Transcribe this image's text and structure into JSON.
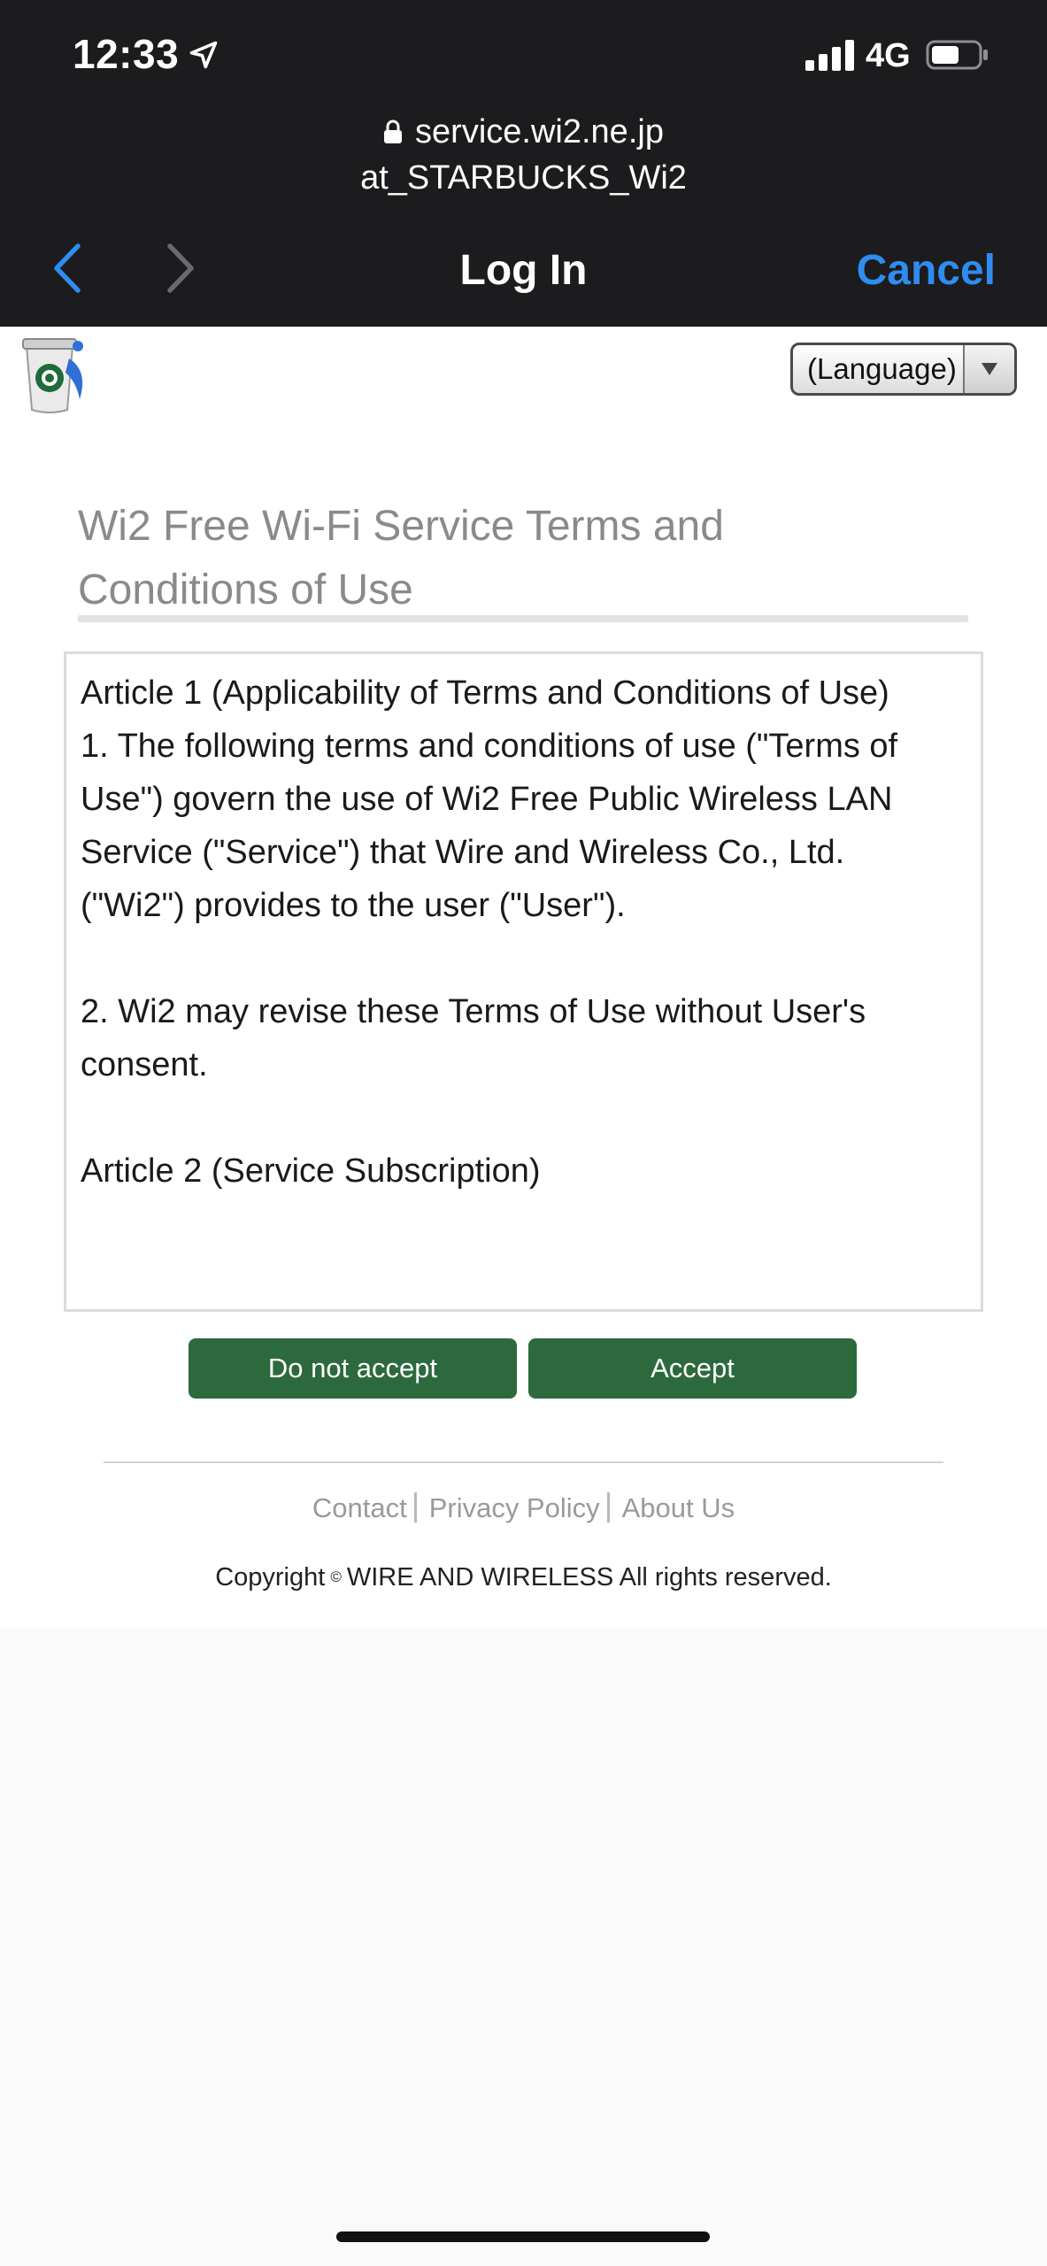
{
  "status_bar": {
    "time": "12:33",
    "network": "4G",
    "icons": [
      "location-arrow-icon",
      "signal-bars-icon",
      "battery-icon"
    ]
  },
  "captive_portal": {
    "host": "service.wi2.ne.jp",
    "ssid": "at_STARBUCKS_Wi2",
    "title": "Log In",
    "cancel_label": "Cancel",
    "accent_color": "#2f8cf0"
  },
  "page": {
    "language_select": "(Language)",
    "terms_title": "Wi2 Free Wi-Fi Service Terms and Conditions of Use",
    "terms": {
      "article1_heading": "Article 1 (Applicability of Terms and Conditions of Use)",
      "article1_p1": "1. The following terms and conditions of use (\"Terms of Use\") govern the use of Wi2 Free Public Wireless LAN Service (\"Service\") that Wire and Wireless Co., Ltd.",
      "article1_p1b": "(\"Wi2\") provides to the user (\"User\").",
      "article1_p2": "2. Wi2 may revise these Terms of Use without User's consent.",
      "article2_heading": "Article 2 (Service Subscription)"
    },
    "buttons": {
      "decline": "Do not accept",
      "accept": "Accept",
      "color": "#2c6a3d"
    },
    "footer": {
      "links": [
        "Contact",
        "Privacy Policy",
        "About Us"
      ],
      "copyright_prefix": "Copyright",
      "copyright_symbol": "©",
      "copyright_suffix": "WIRE AND WIRELESS All rights reserved."
    }
  }
}
